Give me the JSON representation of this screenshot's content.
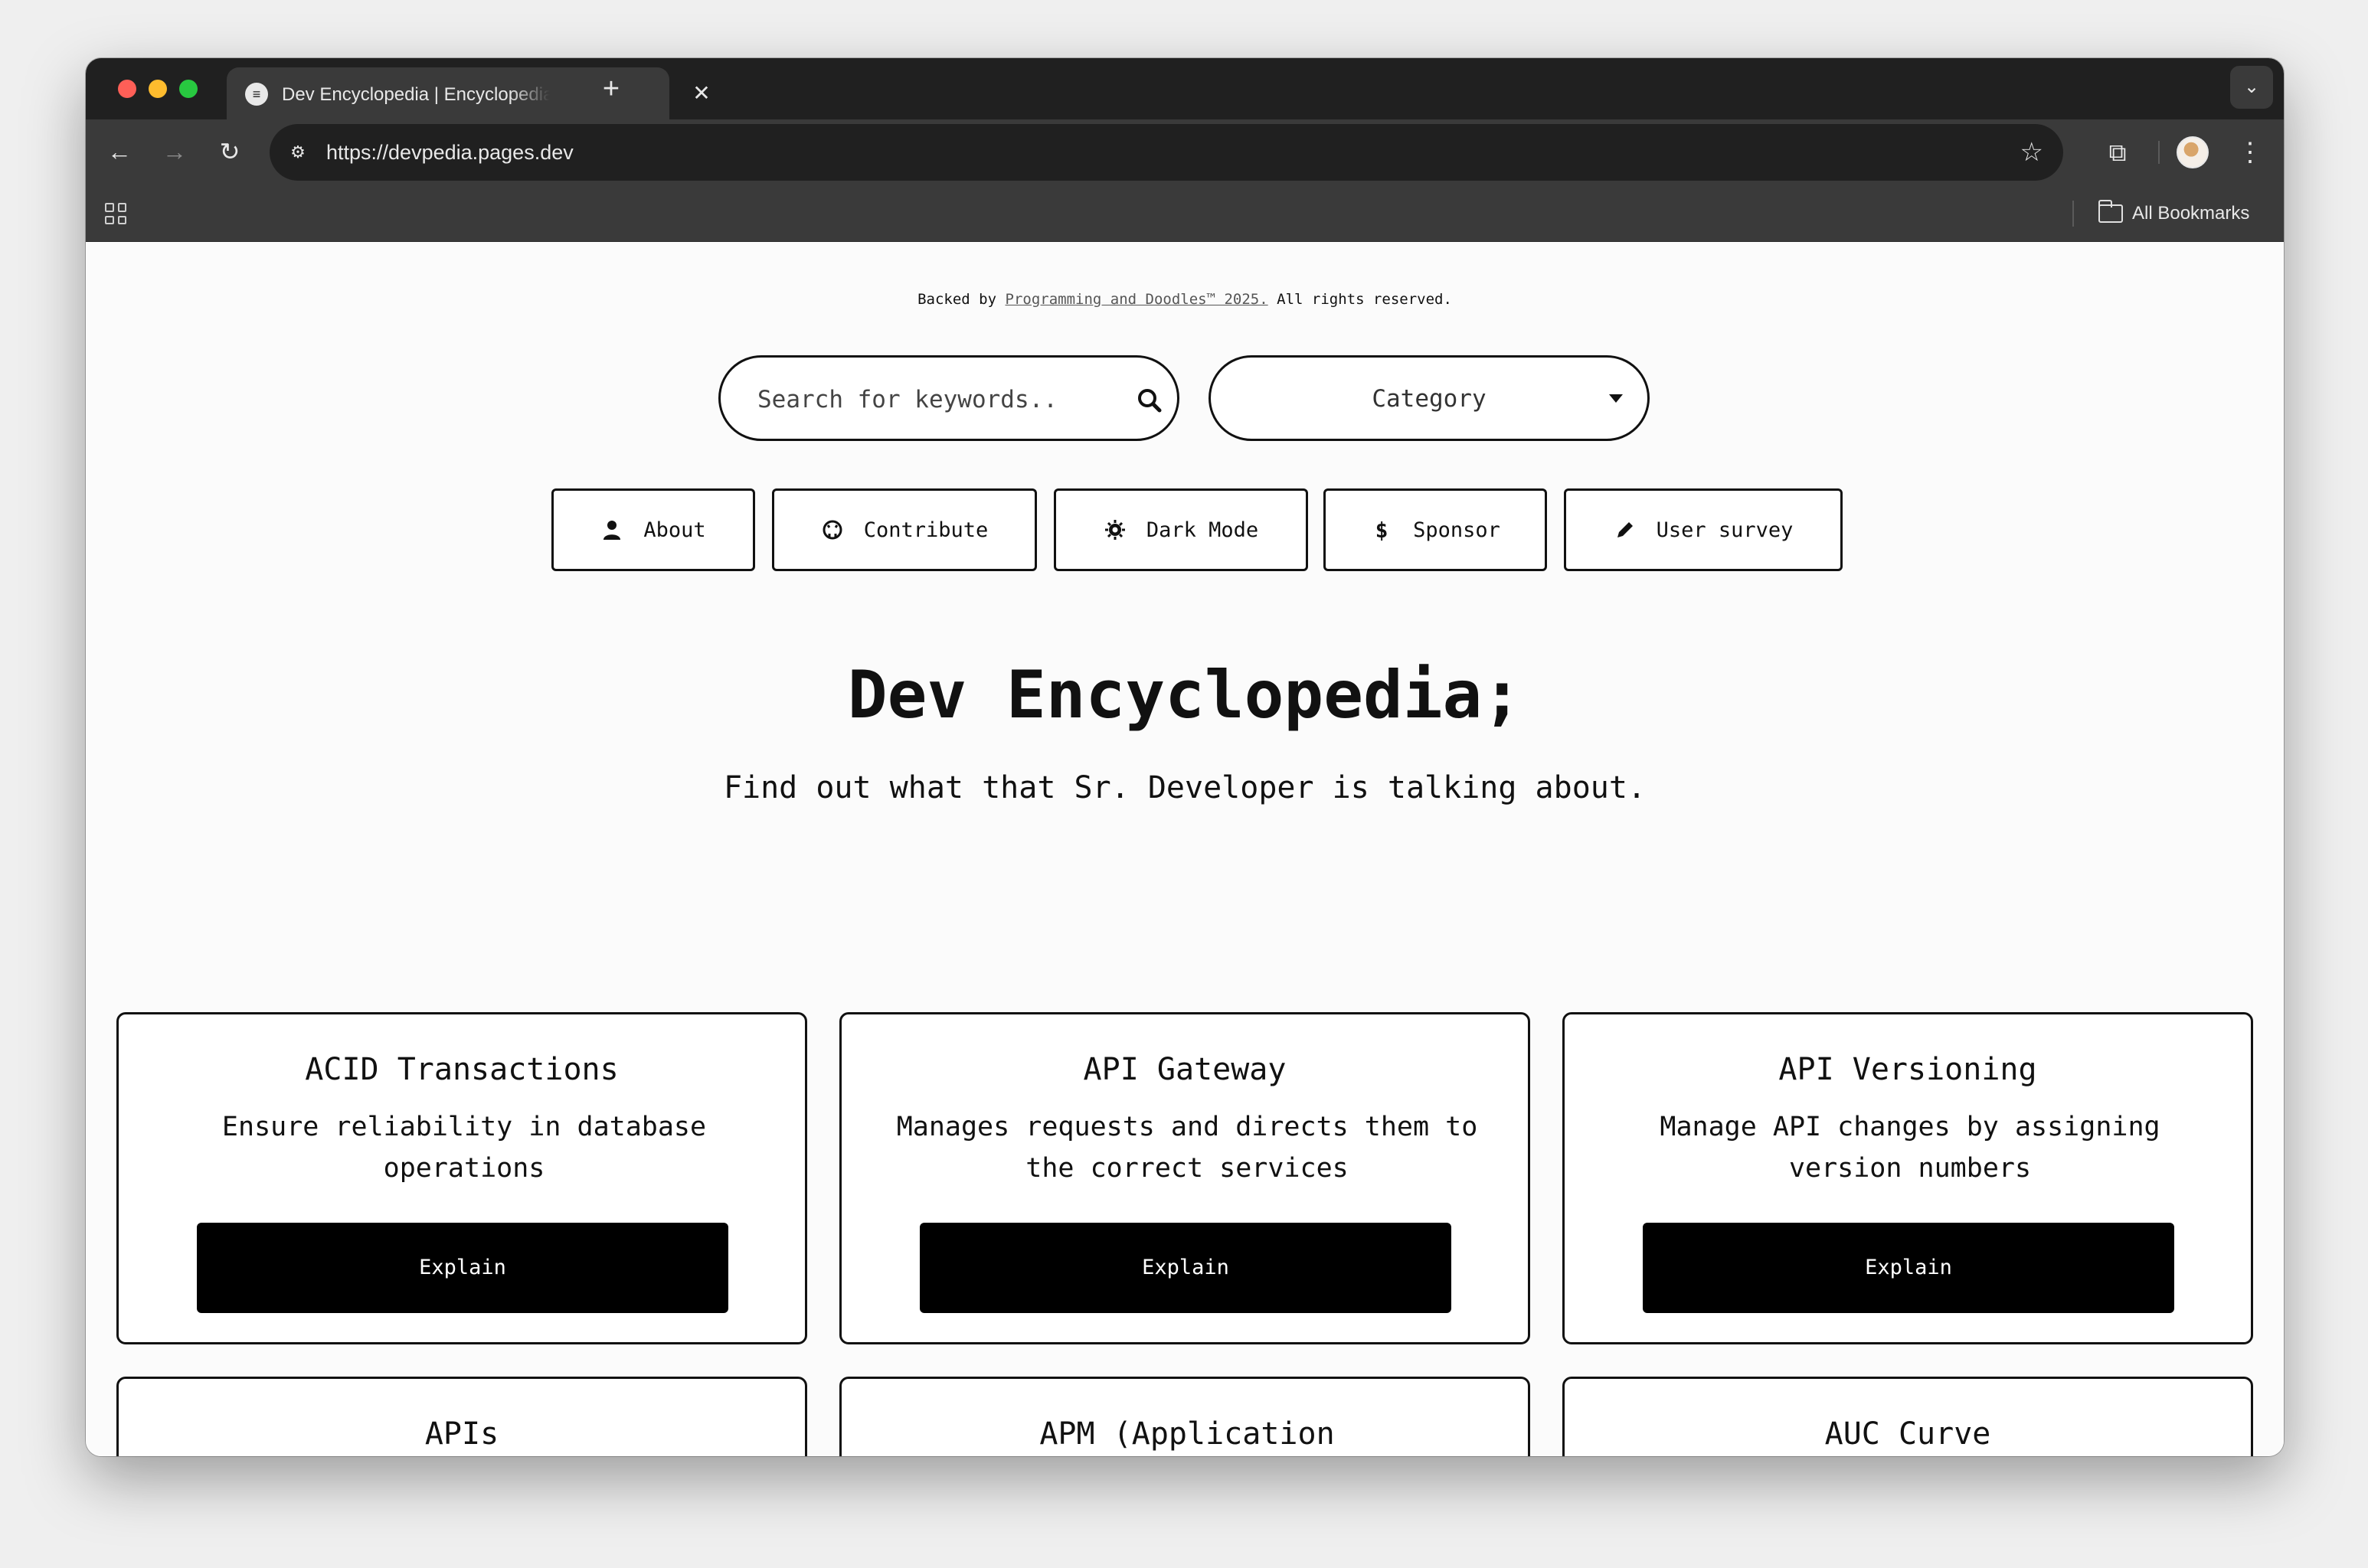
{
  "browser": {
    "tab_title": "Dev Encyclopedia | Encyclopedia",
    "new_tab_symbol": "+",
    "url": "https://devpedia.pages.dev",
    "all_bookmarks": "All Bookmarks"
  },
  "page": {
    "backed_prefix": "Backed by",
    "backed_link": "Programming and Doodles™ 2025.",
    "backed_suffix": "All rights reserved.",
    "search_placeholder": "Search for keywords..",
    "category_label": "Category",
    "nav_buttons": [
      {
        "label": "About",
        "icon": "user-icon"
      },
      {
        "label": "Contribute",
        "icon": "github-icon"
      },
      {
        "label": "Dark Mode",
        "icon": "sun-icon"
      },
      {
        "label": "Sponsor",
        "icon": "dollar-icon"
      },
      {
        "label": "User survey",
        "icon": "pencil-icon"
      }
    ],
    "title": "Dev Encyclopedia;",
    "subtitle": "Find out what that Sr. Developer is talking about.",
    "cards": [
      {
        "title": "ACID Transactions",
        "description": "Ensure reliability in database operations",
        "button": "Explain"
      },
      {
        "title": "API Gateway",
        "description": "Manages requests and directs them to the correct services",
        "button": "Explain"
      },
      {
        "title": "API Versioning",
        "description": "Manage API changes by assigning version numbers",
        "button": "Explain"
      },
      {
        "title": "APIs",
        "description": "",
        "button": ""
      },
      {
        "title": "APM (Application Performance Management)",
        "description": "",
        "button": ""
      },
      {
        "title": "AUC Curve",
        "description": "",
        "button": ""
      }
    ]
  },
  "colors": {
    "accent": "#000000",
    "page_bg": "#fbfbfb",
    "chrome_dark": "#202020",
    "chrome_toolbar": "#3a3a3a"
  }
}
